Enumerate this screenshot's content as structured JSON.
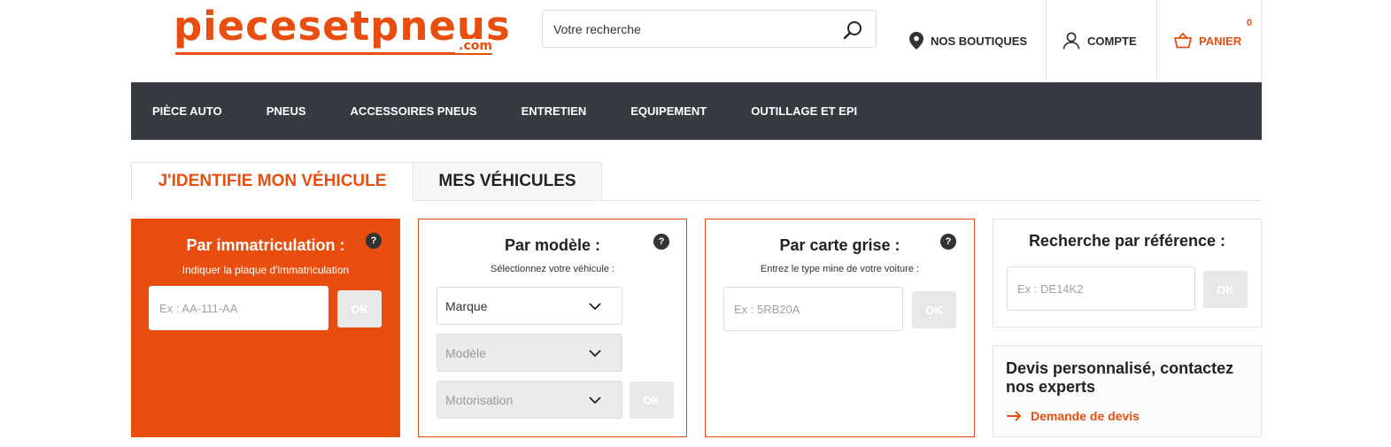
{
  "header": {
    "logo_text": "piecesetpneus",
    "logo_suffix": ".com",
    "search_placeholder": "Votre recherche",
    "shops_label": "NOS BOUTIQUES",
    "account_label": "COMPTE",
    "cart_label": "PANIER",
    "cart_count": "0"
  },
  "nav": {
    "items": [
      "PIÈCE AUTO",
      "PNEUS",
      "ACCESSOIRES PNEUS",
      "ENTRETIEN",
      "EQUIPEMENT",
      "OUTILLAGE ET EPI"
    ]
  },
  "tabs": {
    "identify": "J'IDENTIFIE MON VÉHICULE",
    "my_vehicles": "MES VÉHICULES"
  },
  "immat": {
    "title": "Par immatriculation :",
    "subtitle": "Indiquer la plaque d'immatriculation",
    "placeholder": "Ex : AA-111-AA",
    "ok": "OK",
    "help": "?"
  },
  "modele": {
    "title": "Par modèle :",
    "subtitle": "Sélectionnez votre véhicule :",
    "marque": "Marque",
    "modele": "Modèle",
    "motorisation": "Motorisation",
    "ok": "OK",
    "help": "?"
  },
  "carte": {
    "title": "Par carte grise :",
    "subtitle": "Entrez le type mine de votre voiture :",
    "placeholder": "Ex : 5RB20A",
    "ok": "OK",
    "help": "?"
  },
  "reference": {
    "title": "Recherche par référence :",
    "placeholder": "Ex : DE14K2",
    "ok": "OK"
  },
  "devis": {
    "title": "Devis personnalisé, contactez nos experts",
    "link": "Demande de devis"
  },
  "colors": {
    "accent": "#e84e0f",
    "nav_bg": "#353b41"
  }
}
